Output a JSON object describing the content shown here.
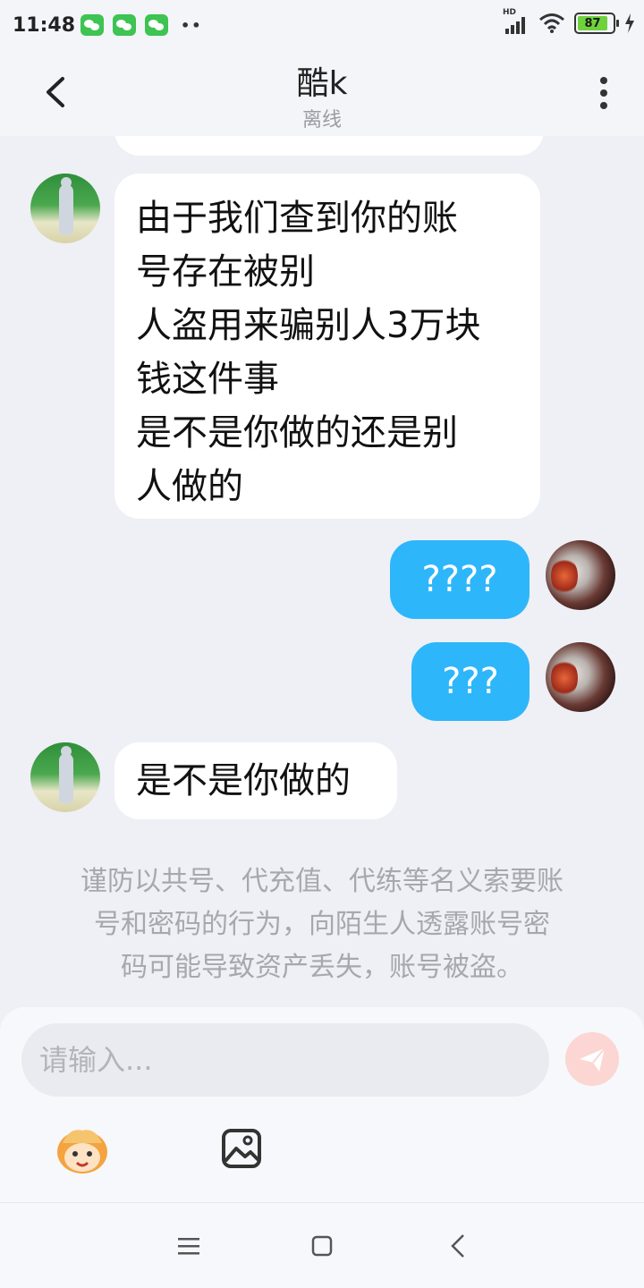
{
  "status_bar": {
    "time": "11:48",
    "dots": "••",
    "hd_label": "HD",
    "battery_level": "87",
    "battery_fraction": 0.87,
    "app_icons": [
      "wechat-icon",
      "wechat-icon",
      "wechat-icon"
    ]
  },
  "header": {
    "title": "酷k",
    "subtitle": "离线"
  },
  "messages": [
    {
      "side": "left",
      "lines": [
        "由于我们查到你的账",
        "号存在被别",
        "人盗用来骗别人3万块",
        "钱这件事",
        "是不是你做的还是别",
        "人做的"
      ]
    },
    {
      "side": "right",
      "text": "????"
    },
    {
      "side": "right",
      "text": "???"
    },
    {
      "side": "left",
      "text": "是不是你做的"
    }
  ],
  "notice": {
    "lines": [
      "谨防以共号、代充值、代练等名义索要账",
      "号和密码的行为，向陌生人透露账号密",
      "码可能导致资产丢失，账号被盗。"
    ]
  },
  "composer": {
    "placeholder": "请输入..."
  },
  "colors": {
    "background": "#eef0f5",
    "incoming_bubble": "#ffffff",
    "outgoing_bubble": "#2eb6fb",
    "send_button_disabled": "#fbd6d2",
    "battery": "#6fd23d"
  }
}
